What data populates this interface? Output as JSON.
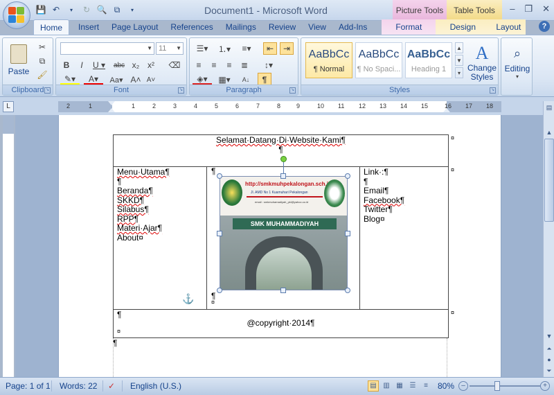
{
  "window": {
    "title": "Document1 - Microsoft Word",
    "context_picture_tools": "Picture Tools",
    "context_table_tools": "Table Tools",
    "controls": [
      "–",
      "❐",
      "✕"
    ]
  },
  "tabs": [
    "Home",
    "Insert",
    "Page Layout",
    "References",
    "Mailings",
    "Review",
    "View",
    "Add-Ins",
    "Format",
    "Design",
    "Layout"
  ],
  "ribbon": {
    "clipboard": {
      "label": "Clipboard",
      "paste": "Paste"
    },
    "font": {
      "label": "Font",
      "font_name": "",
      "font_size": "11"
    },
    "paragraph": {
      "label": "Paragraph"
    },
    "styles": {
      "label": "Styles",
      "items": [
        {
          "sample": "AaBbCc",
          "name": "¶ Normal"
        },
        {
          "sample": "AaBbCc",
          "name": "¶ No Spaci..."
        },
        {
          "sample": "AaBbCc",
          "name": "Heading 1"
        }
      ],
      "change_styles": "Change Styles"
    },
    "editing": {
      "label": "Editing"
    }
  },
  "document": {
    "header_text": "Selamat·Datang·Di·Website·Kami¶",
    "pilcrow": "¶",
    "end_cell": "¤",
    "menu": [
      "Menu·Utama¶",
      "¶",
      "Beranda¶",
      "SKKD¶",
      "Silabus¶",
      "RPP¶",
      "Materi·Ajar¶",
      "About¤"
    ],
    "links": [
      "Link·:¶",
      "¶",
      "Email¶",
      "Facebook¶",
      "Twitter¶",
      "Blog¤"
    ],
    "footer_text": "@copyright·2014¶",
    "picture": {
      "url_text": "http://smkmuhpekalongan.sch.id",
      "address_text": "Jl. AMD No 1 Kuamuhari Pekalongan",
      "email_text": "email : smkmuhamadiyah_pkl@yahoo.co.id",
      "sign_text": "SMK MUHAMMADIYAH"
    }
  },
  "ruler": {
    "numbers": [
      "2",
      "1",
      "1",
      "2",
      "3",
      "4",
      "5",
      "6",
      "7",
      "8",
      "9",
      "10",
      "11",
      "12",
      "13",
      "14",
      "15",
      "16",
      "17",
      "18"
    ]
  },
  "status": {
    "page": "Page: 1 of 1",
    "words": "Words: 22",
    "language": "English (U.S.)",
    "zoom": "80%"
  }
}
